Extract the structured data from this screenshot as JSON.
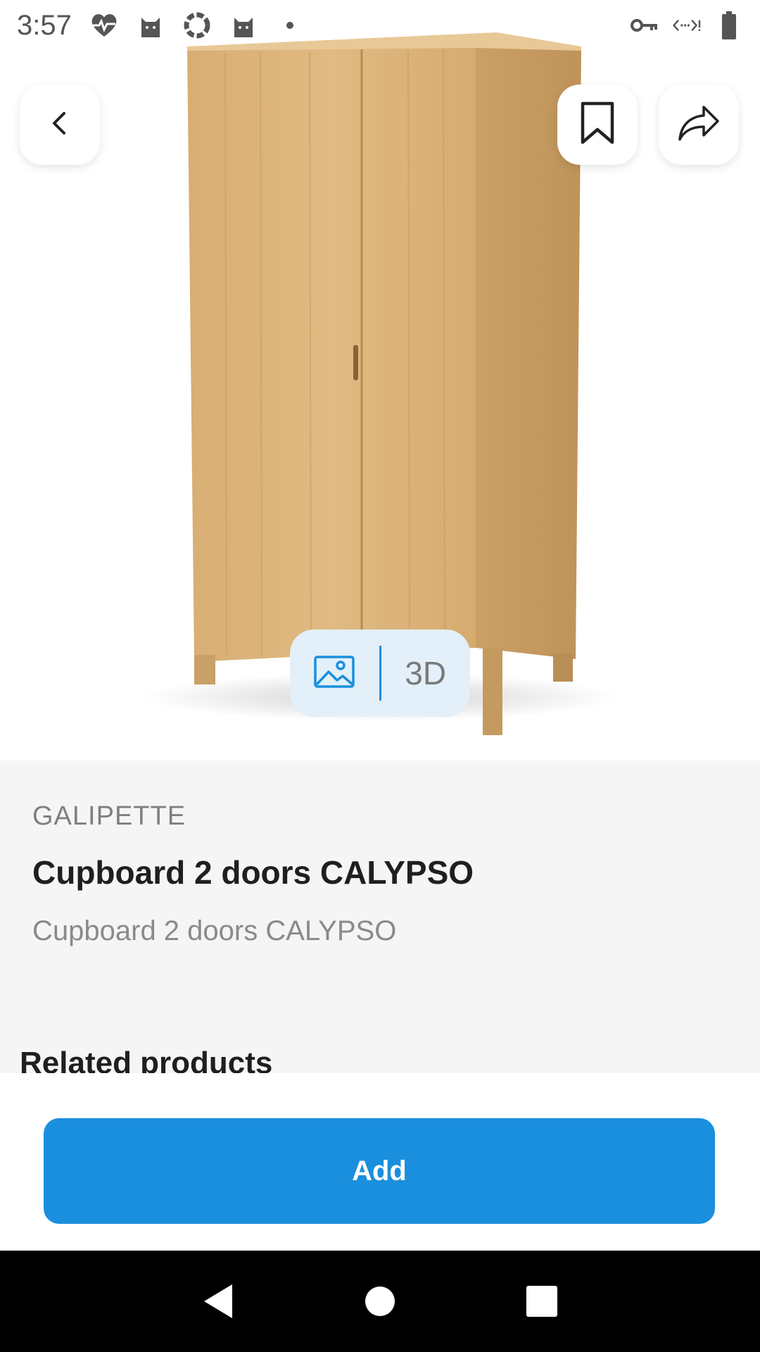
{
  "status_bar": {
    "time": "3:57",
    "left_icons": [
      "heart-pulse-icon",
      "cat-icon",
      "sync-icon",
      "cat-icon",
      "dot-icon"
    ],
    "right_icons": [
      "vpn-key-icon",
      "data-saver-icon",
      "battery-icon"
    ]
  },
  "hero": {
    "image": "wardrobe-product-image"
  },
  "top_actions": {
    "back_icon": "chevron-left-icon",
    "bookmark_icon": "bookmark-icon",
    "share_icon": "share-icon"
  },
  "media_toggle": {
    "image_icon": "image-icon",
    "three_d_label": "3D"
  },
  "product": {
    "brand": "GALIPETTE",
    "title": "Cupboard 2 doors CALYPSO",
    "subtitle": "Cupboard 2 doors CALYPSO"
  },
  "related": {
    "heading": "Related products"
  },
  "action": {
    "add_label": "Add"
  },
  "colors": {
    "accent": "#1a8fde",
    "toggle_bg": "#e3f0f9",
    "info_bg": "#f5f5f5",
    "wood": "#d9b27a"
  },
  "nav_bar": {
    "back_icon": "nav-back-icon",
    "home_icon": "nav-home-icon",
    "recents_icon": "nav-recents-icon"
  }
}
